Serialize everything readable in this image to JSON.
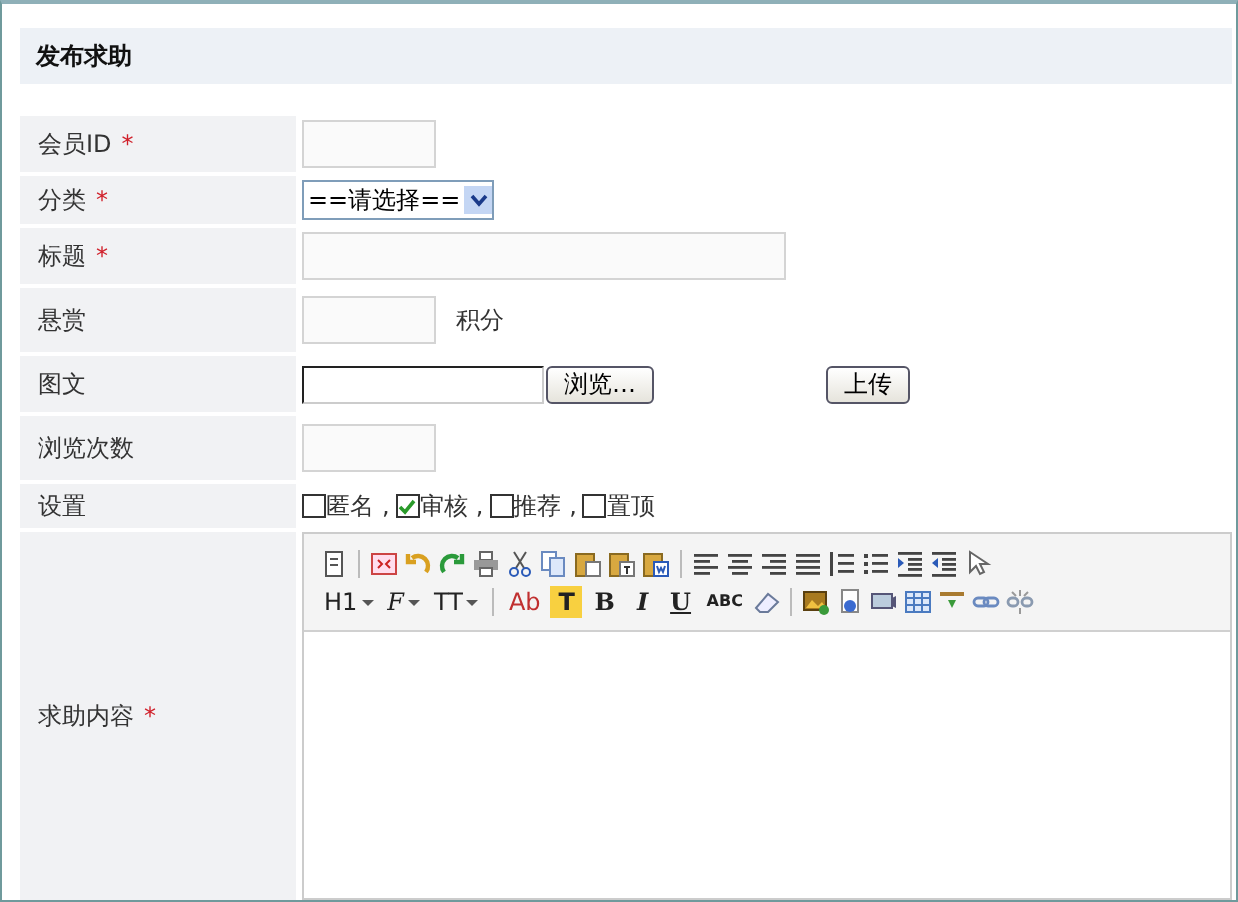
{
  "panel": {
    "title": "发布求助"
  },
  "rows": [
    {
      "label": "会员ID",
      "required_mark": "*",
      "kind": "short_input"
    },
    {
      "label": "分类",
      "required_mark": "*",
      "kind": "select",
      "value": "==请选择=="
    },
    {
      "label": "标题",
      "required_mark": "*",
      "kind": "long_input"
    },
    {
      "label": "悬赏",
      "kind": "short_input",
      "unit": "积分"
    },
    {
      "label": "图文",
      "kind": "file",
      "browse": "浏览…",
      "upload": "上传"
    },
    {
      "label": "浏览次数",
      "kind": "short_input"
    },
    {
      "label": "设置",
      "kind": "checkboxes",
      "delimiter": ",",
      "options": [
        {
          "label": "匿名",
          "checked": false
        },
        {
          "label": "审核",
          "checked": true
        },
        {
          "label": "推荐",
          "checked": false
        },
        {
          "label": "置顶",
          "checked": false
        }
      ]
    },
    {
      "label": "求助内容",
      "required_mark": "*",
      "kind": "editor"
    }
  ],
  "editor": {
    "toolbar": [
      [
        {
          "kind": "icon"
        },
        {
          "kind": "separator"
        },
        {
          "kind": "icon"
        },
        {
          "kind": "icon"
        },
        {
          "kind": "icon"
        },
        {
          "kind": "icon"
        },
        {
          "kind": "icon"
        },
        {
          "kind": "icon"
        },
        {
          "kind": "icon"
        },
        {
          "kind": "icon"
        },
        {
          "kind": "icon"
        },
        {
          "kind": "separator"
        },
        {
          "kind": "icon"
        },
        {
          "kind": "icon"
        },
        {
          "kind": "icon"
        },
        {
          "kind": "icon"
        },
        {
          "kind": "icon"
        },
        {
          "kind": "icon"
        },
        {
          "kind": "icon"
        },
        {
          "kind": "icon"
        },
        {
          "kind": "icon"
        }
      ],
      [
        {
          "kind": "dropdown",
          "text": "H1"
        },
        {
          "kind": "dropdown",
          "text": "F"
        },
        {
          "kind": "dropdown",
          "text": "TT"
        },
        {
          "kind": "separator"
        },
        {
          "kind": "text",
          "text": "Ab"
        },
        {
          "kind": "text",
          "text": "T"
        },
        {
          "kind": "text",
          "text": "B"
        },
        {
          "kind": "text",
          "text": "I"
        },
        {
          "kind": "text",
          "text": "U"
        },
        {
          "kind": "text",
          "text": "ABC"
        },
        {
          "kind": "icon"
        },
        {
          "kind": "separator"
        },
        {
          "kind": "icon"
        },
        {
          "kind": "icon"
        },
        {
          "kind": "icon"
        },
        {
          "kind": "icon"
        },
        {
          "kind": "icon"
        },
        {
          "kind": "icon"
        },
        {
          "kind": "icon"
        }
      ]
    ]
  }
}
